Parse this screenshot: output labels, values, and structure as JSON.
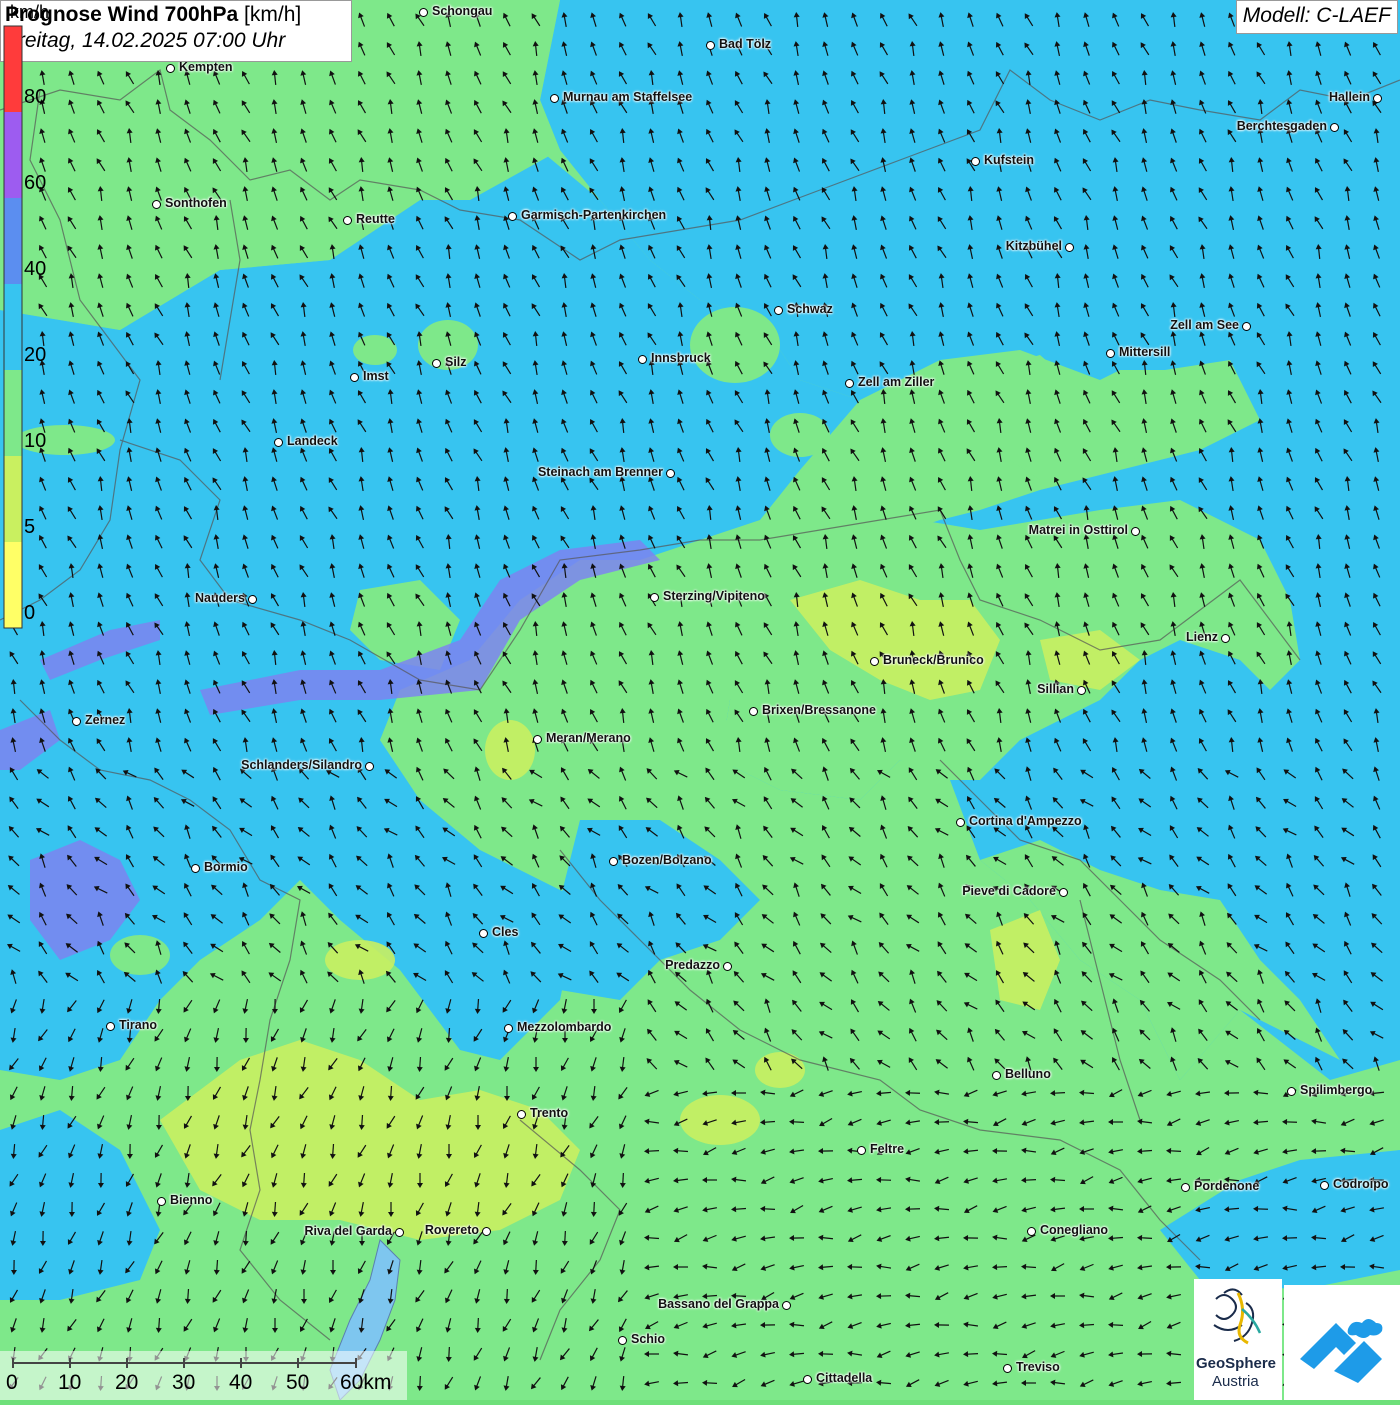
{
  "header": {
    "title_bold": "Prognose Wind 700hPa",
    "title_unit": "[km/h]",
    "subtitle": "Freitag, 14.02.2025 07:00 Uhr"
  },
  "model": {
    "label": "Modell: C-LAEF"
  },
  "legend": {
    "unit": "km/h",
    "labels": [
      "80",
      "60",
      "40",
      "20",
      "10",
      "5",
      "0"
    ],
    "colors": {
      "band_80": "#ff3b3b",
      "band_60": "#9d5cf0",
      "band_40": "#5b8ef0",
      "band_20": "#37c4f0",
      "band_10": "#7ee88a",
      "band_5": "#c9f060",
      "band_0": "#ffff66"
    }
  },
  "scalebar": {
    "labels": [
      "0",
      "10",
      "20",
      "30",
      "40",
      "50",
      "60km"
    ]
  },
  "logos": {
    "geosphere_line1": "GeoSphere",
    "geosphere_line2": "Austria",
    "app_icon": "mountain-cloud-icon"
  },
  "cities": [
    "Schongau",
    "Bad Tölz",
    "Kempten",
    "Murnau am Staffelsee",
    "Hallein",
    "Berchtesgaden",
    "Kufstein",
    "Sonthofen",
    "Reutte",
    "Garmisch-Partenkirchen",
    "Kitzbühel",
    "Schwaz",
    "Zell am See",
    "Mittersill",
    "Imst",
    "Silz",
    "Innsbruck",
    "Zell am Ziller",
    "Landeck",
    "Steinach am Brenner",
    "Matrei in Osttirol",
    "Nauders",
    "Sterzing/Vipiteno",
    "Lienz",
    "Bruneck/Brunico",
    "Sillian",
    "Zernez",
    "Brixen/Bressanone",
    "Meran/Merano",
    "Schlanders/Silandro",
    "Cortina d'Ampezzo",
    "Bozen/Bolzano",
    "Bormio",
    "Pieve di Cadore",
    "Cles",
    "Predazzo",
    "Tirano",
    "Mezzolombardo",
    "Belluno",
    "Spilimbergo",
    "Trento",
    "Feltre",
    "Pordenone",
    "Codroipo",
    "Bienno",
    "Riva del Garda",
    "Rovereto",
    "Conegliano",
    "Bassano del Grappa",
    "Schio",
    "Treviso",
    "Cittadella"
  ],
  "colors": {
    "wind_fast": "#37c4f0",
    "wind_medium": "#7ee88a",
    "wind_slow": "#c9f060",
    "wind_calm": "#ffff66",
    "wind_strong": "#7c84f0"
  }
}
